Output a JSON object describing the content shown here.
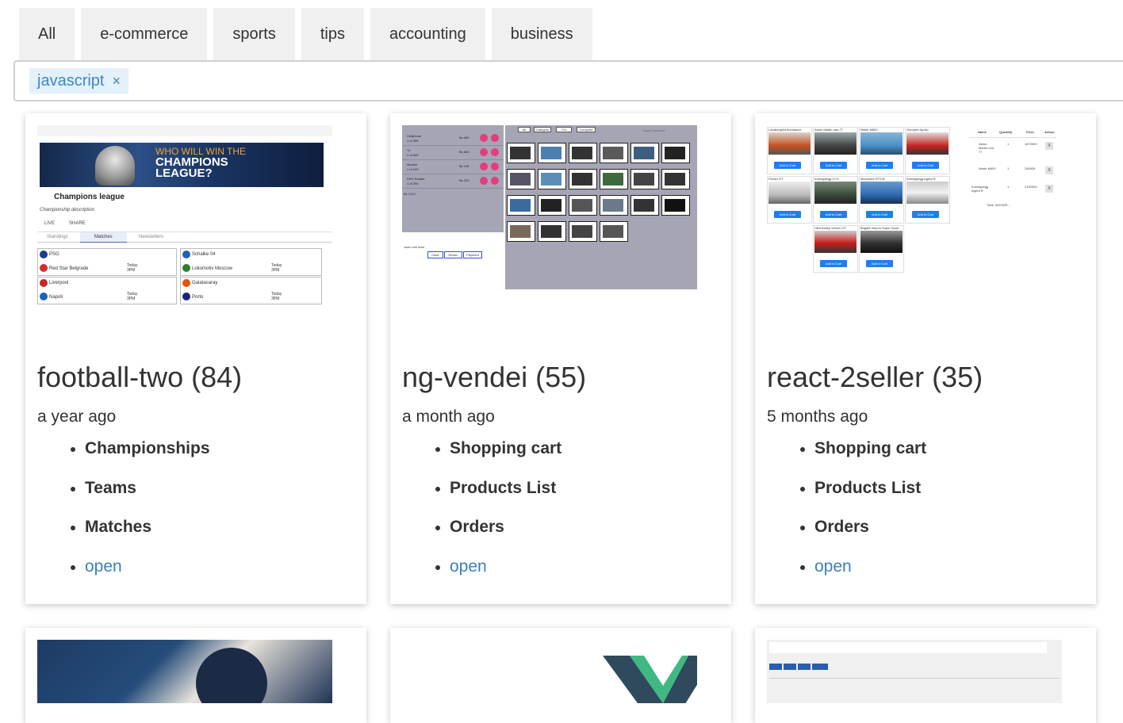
{
  "filter_tabs": [
    "All",
    "e-commerce",
    "sports",
    "tips",
    "accounting",
    "business"
  ],
  "tag_filter": {
    "chips": [
      {
        "label": "javascript",
        "remove": "×"
      }
    ]
  },
  "cards": [
    {
      "title": "football-two (84)",
      "date": "a year ago",
      "features": [
        "Championships",
        "Teams",
        "Matches"
      ],
      "link": "open",
      "thumbnail": {
        "banner_line1": "WHO WILL WIN THE",
        "banner_line2": "CHAMPIONS",
        "banner_line3": "LEAGUE?",
        "name": "Champions league",
        "description": "Championship description",
        "live": "LIVE",
        "share": "SHARE",
        "tabs": [
          "Standings",
          "Matches",
          "Newsletters"
        ],
        "matches": [
          {
            "home": "PSG",
            "away": "Red Star Belgrade",
            "when": "Today",
            "time": "3PM"
          },
          {
            "home": "Schalke 04",
            "away": "Lokomotiv Moscow",
            "when": "Today",
            "time": "3PM"
          },
          {
            "home": "Liverpool",
            "away": "Napoli",
            "when": "Today",
            "time": "3PM"
          },
          {
            "home": "Galatasaray",
            "away": "Porto",
            "when": "Today",
            "time": "3PM"
          }
        ],
        "colors": {
          "psg": "#1d3d8f",
          "redstar": "#d32f2f",
          "schalke": "#1f5fb8",
          "loko": "#2e7d32",
          "liverpool": "#c62828",
          "napoli": "#1565c0",
          "galatasaray": "#e65100",
          "porto": "#1a237e"
        }
      }
    },
    {
      "title": "ng-vendei (55)",
      "date": "a month ago",
      "features": [
        "Shopping cart",
        "Products List",
        "Orders"
      ],
      "link": "open",
      "thumbnail": {
        "tabs": [
          "All",
          "Category",
          "TVs",
          "Computer"
        ],
        "search": "Search product",
        "cart_rows": [
          {
            "name": "Cellphone",
            "qty": "1 of 399",
            "price": "Bs 400"
          },
          {
            "name": "Tv",
            "qty": "1 of 699",
            "price": "Bs 600"
          },
          {
            "name": "Monitor",
            "qty": "1 of 199",
            "price": "Bs 130"
          },
          {
            "name": "DVD Reader",
            "qty": "1 of 299",
            "price": "Bs 220"
          }
        ],
        "total": "Bs 1400",
        "buttons": [
          "Clear",
          "Return",
          "Payment"
        ],
        "customer": "Juan Luis Arce"
      }
    },
    {
      "title": "react-2seller (35)",
      "date": "5 months ago",
      "features": [
        "Shopping cart",
        "Products List",
        "Orders"
      ],
      "link": "open",
      "thumbnail": {
        "cars": [
          "Lamborghini Aventador",
          "Aston Martin one-77",
          "Noble M600",
          "Gumpert Apollo",
          "Ferrari GT",
          "Koenigsegg CCX",
          "Mercedes GT3-B",
          "Koenigsegg Agera R",
          "Hennessey Venom GT",
          "Bugatti Veyron Super Sport"
        ],
        "add_label": "Add to Cart",
        "table_headers": [
          "Name",
          "Quantity",
          "Price",
          "Action"
        ],
        "table_rows": [
          {
            "name": "Aston Martin one-77",
            "qty": "1",
            "price": "1870000",
            "action": "X"
          },
          {
            "name": "Noble M600",
            "qty": "1",
            "price": "250926",
            "action": "X"
          },
          {
            "name": "Koenigsegg Agera R",
            "qty": "1",
            "price": "2100000",
            "action": "X"
          }
        ],
        "total": "Total: 4220926..."
      }
    }
  ]
}
